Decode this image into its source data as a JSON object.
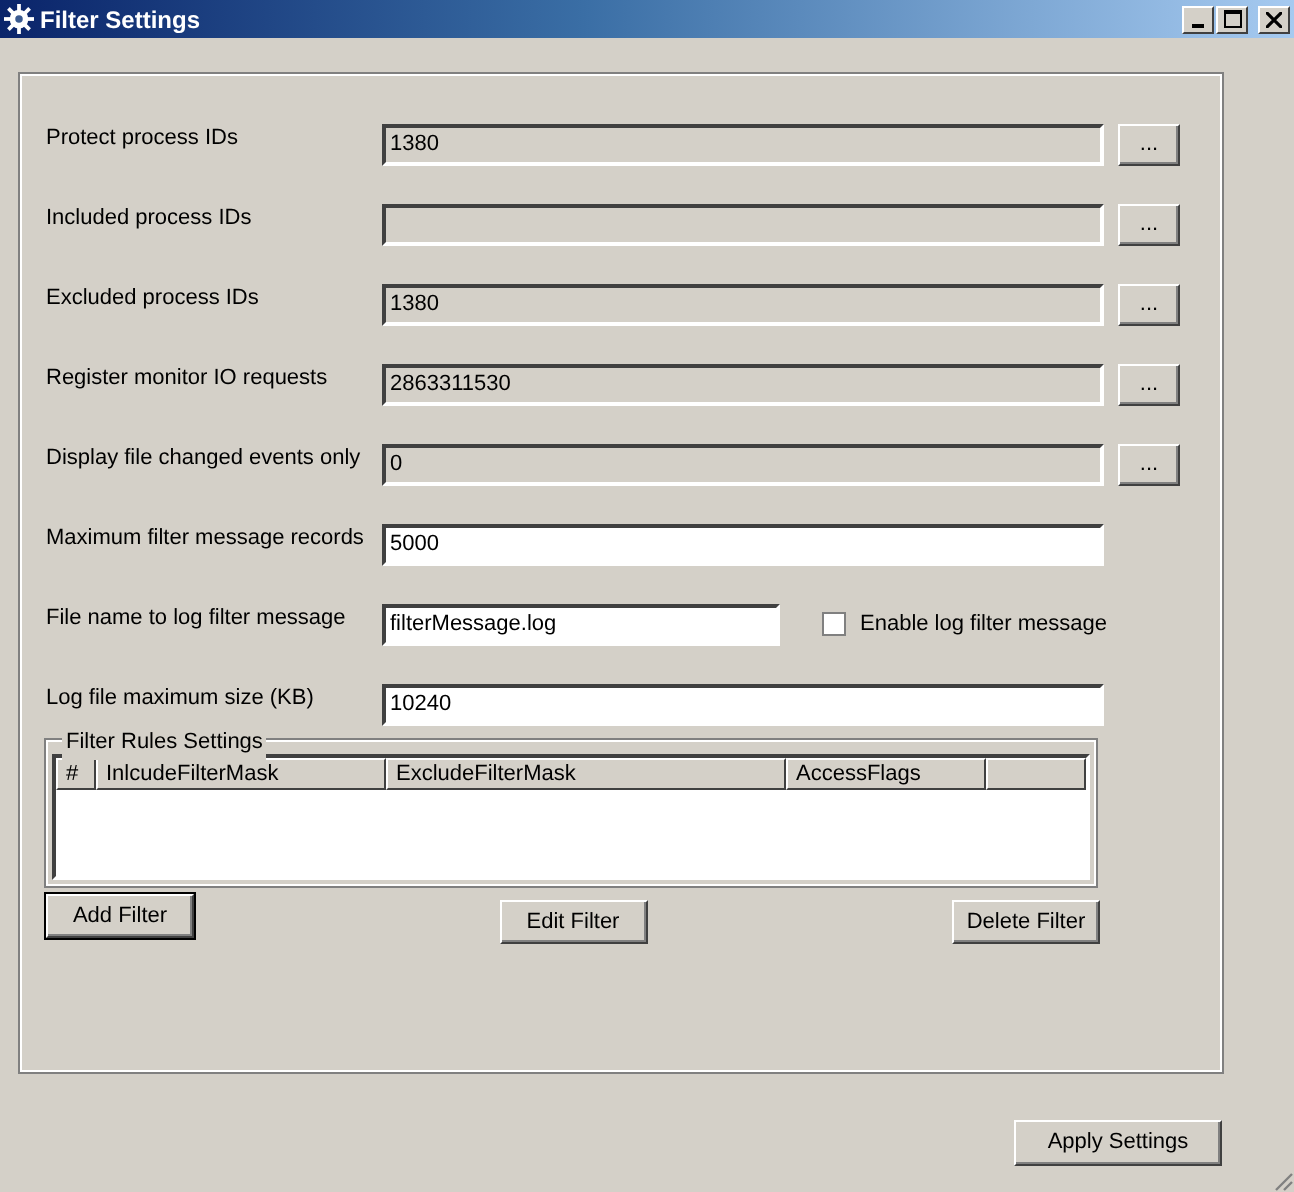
{
  "window": {
    "title": "Filter Settings"
  },
  "fields": [
    {
      "kind": "browse",
      "label": "Protect process IDs",
      "value": "1380",
      "readonly": true,
      "button": "..."
    },
    {
      "kind": "browse",
      "label": "Included process IDs",
      "readonly": true,
      "button": "..."
    },
    {
      "kind": "browse",
      "label": "Excluded process IDs",
      "value": "1380",
      "readonly": true,
      "button": "..."
    },
    {
      "kind": "browse",
      "label": "Register monitor IO requests",
      "value": "2863311530",
      "readonly": true,
      "button": "..."
    },
    {
      "kind": "browse",
      "label": "Display file changed events only",
      "value": "0",
      "readonly": true,
      "button": "..."
    },
    {
      "kind": "plain",
      "label": "Maximum filter message records",
      "value": "5000",
      "readonly": false
    },
    {
      "kind": "checkbox",
      "label": "File name to log filter message",
      "value": "filterMessage.log",
      "readonly": false,
      "checkbox_label": "Enable log filter message",
      "checked": false
    },
    {
      "kind": "plain",
      "label": "Log file maximum size (KB)",
      "value": "10240",
      "readonly": false
    }
  ],
  "filter_rules": {
    "title": "Filter Rules Settings",
    "columns": [
      "#",
      "InlcudeFilterMask",
      "ExcludeFilterMask",
      "AccessFlags"
    ],
    "buttons": [
      {
        "label": "Add Filter",
        "default": true
      },
      {
        "label": "Edit Filter",
        "default": false
      },
      {
        "label": "Delete Filter",
        "default": false
      }
    ]
  },
  "apply_button": "Apply Settings"
}
